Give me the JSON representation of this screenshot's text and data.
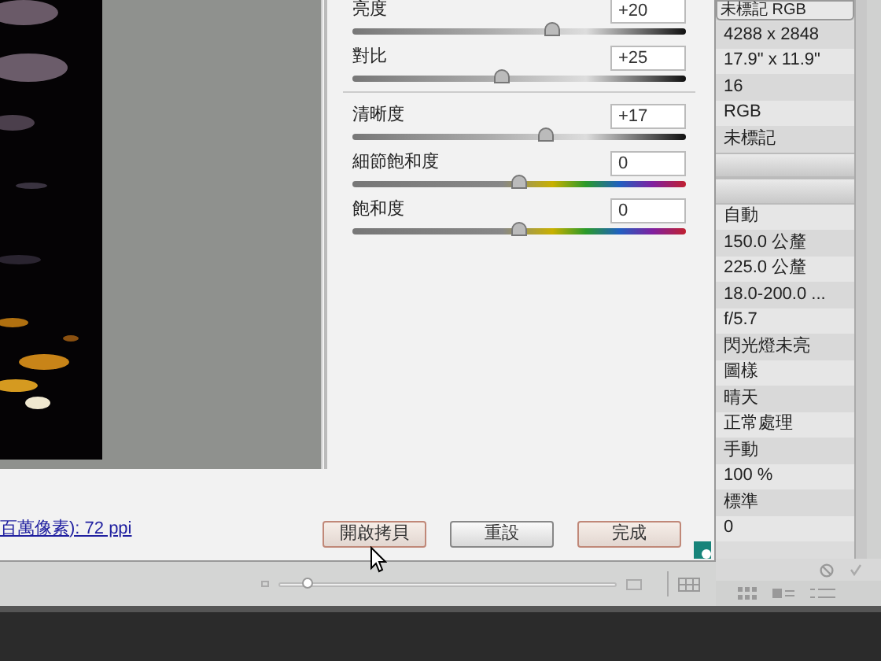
{
  "adjustments": [
    {
      "label": "亮度",
      "value": "+20",
      "level": 0.6,
      "kind": "tone"
    },
    {
      "label": "對比",
      "value": "+25",
      "level": 0.45,
      "kind": "tone"
    },
    {
      "kind": "divider"
    },
    {
      "label": "清晰度",
      "value": "+17",
      "level": 0.58,
      "kind": "tone"
    },
    {
      "label": "細節飽和度",
      "value": "0",
      "level": 0.5,
      "kind": "spectrum"
    },
    {
      "label": "飽和度",
      "value": "0",
      "level": 0.5,
      "kind": "spectrum"
    }
  ],
  "link": "百萬像素): 72 ppi",
  "buttons": [
    {
      "label": "開啟拷貝",
      "emphasized": true
    },
    {
      "label": "重設",
      "emphasized": false
    },
    {
      "label": "完成",
      "emphasized": true
    }
  ],
  "zoom_slider": {
    "level": 0.08
  },
  "metadata": {
    "header": "未標記 RGB",
    "items": [
      {
        "kind": "value",
        "text": "4288 x 2848"
      },
      {
        "kind": "value",
        "text": "17.9\" x 11.9\""
      },
      {
        "kind": "value",
        "text": "16"
      },
      {
        "kind": "value",
        "text": "RGB"
      },
      {
        "kind": "value",
        "text": "未標記"
      },
      {
        "kind": "group"
      },
      {
        "kind": "group"
      },
      {
        "kind": "value",
        "text": "自動"
      },
      {
        "kind": "value",
        "text": "150.0 公釐"
      },
      {
        "kind": "value",
        "text": "225.0 公釐"
      },
      {
        "kind": "value",
        "text": "18.0-200.0 ..."
      },
      {
        "kind": "value",
        "text": "f/5.7"
      },
      {
        "kind": "value",
        "text": "閃光燈未亮"
      },
      {
        "kind": "value",
        "text": "圖樣"
      },
      {
        "kind": "value",
        "text": "晴天"
      },
      {
        "kind": "value",
        "text": "正常處理"
      },
      {
        "kind": "value",
        "text": "手動"
      },
      {
        "kind": "value",
        "text": "100 %"
      },
      {
        "kind": "value",
        "text": "標準"
      },
      {
        "kind": "value",
        "text": "0"
      }
    ]
  }
}
